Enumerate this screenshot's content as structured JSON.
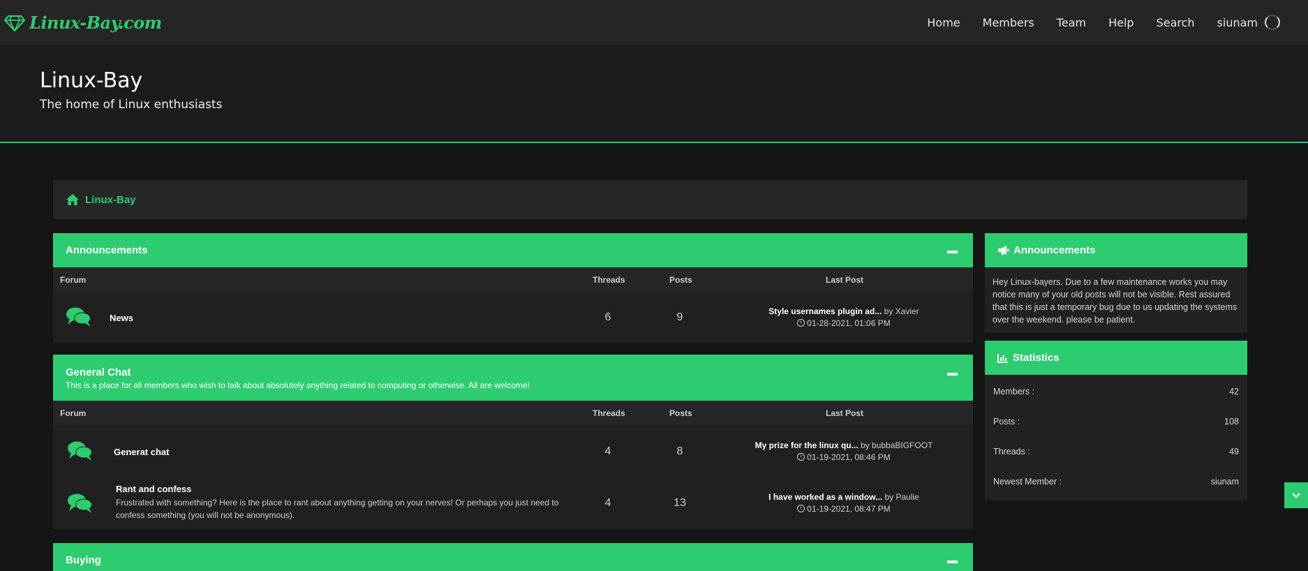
{
  "brand": {
    "name": "Linux-Bay.com"
  },
  "nav": {
    "home": "Home",
    "members": "Members",
    "team": "Team",
    "help": "Help",
    "search": "Search",
    "user": "siunam"
  },
  "hero": {
    "title": "Linux-Bay",
    "subtitle": "The home of Linux enthusiasts"
  },
  "breadcrumb": {
    "label": "Linux-Bay"
  },
  "columns": {
    "forum": "Forum",
    "threads": "Threads",
    "posts": "Posts",
    "last_post": "Last Post"
  },
  "categories": [
    {
      "title": "Announcements",
      "description": "",
      "forums": [
        {
          "name": "News",
          "description": "",
          "threads": "6",
          "posts": "9",
          "last_title": "Style usernames plugin ad...",
          "last_by": "by Xavier",
          "last_date": "01-28-2021, 01:06 PM"
        }
      ]
    },
    {
      "title": "General Chat",
      "description": "This is a place for all members who wish to talk about absolutely anything related to computing or otherwise. All are welcome!",
      "forums": [
        {
          "name": "Generat chat",
          "description": "",
          "threads": "4",
          "posts": "8",
          "last_title": "My prize for the linux qu...",
          "last_by": "by bubbaBIGFOOT",
          "last_date": "01-19-2021, 08:46 PM"
        },
        {
          "name": "Rant and confess",
          "description": "Frustrated with something? Here is the place to rant about anything getting on your nerves! Or perhaps you just need to confess something (you will not be anonymous).",
          "threads": "4",
          "posts": "13",
          "last_title": "I have worked as a window...",
          "last_by": "by Paulie",
          "last_date": "01-19-2021, 08:47 PM"
        }
      ]
    },
    {
      "title": "Buying"
    }
  ],
  "sidebar": {
    "announcements": {
      "title": "Announcements",
      "text": "Hey Linux-bayers. Due to a few maintenance works you may notice many of your old posts will not be visible. Rest assured that this is just a temporary bug due to us updating the systems over the weekend. please be patient."
    },
    "statistics": {
      "title": "Statistics",
      "rows": [
        {
          "label": "Members :",
          "value": "42"
        },
        {
          "label": "Posts :",
          "value": "108"
        },
        {
          "label": "Threads :",
          "value": "49"
        },
        {
          "label": "Newest Member :",
          "value": "siunam"
        }
      ]
    }
  },
  "colors": {
    "accent": "#2ecc71",
    "background": "#151515",
    "panel": "#202020"
  },
  "icons": [
    "gem-icon",
    "home-icon",
    "comments-icon",
    "minus-icon",
    "bullhorn-icon",
    "chart-icon",
    "chevron-down-icon",
    "clock-icon"
  ]
}
